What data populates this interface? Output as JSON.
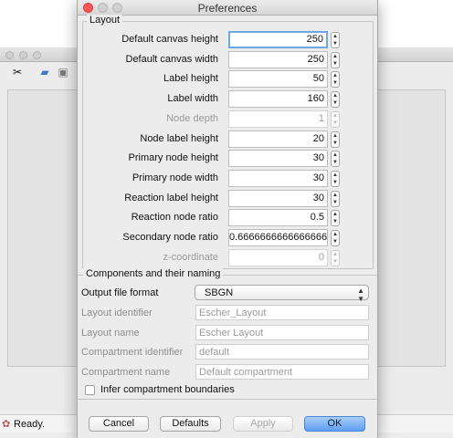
{
  "dialog": {
    "title": "Preferences"
  },
  "layout_group": {
    "legend": "Layout",
    "rows": [
      {
        "label": "Default canvas height",
        "value": "250",
        "enabled": true
      },
      {
        "label": "Default canvas width",
        "value": "250",
        "enabled": true
      },
      {
        "label": "Label height",
        "value": "50",
        "enabled": true
      },
      {
        "label": "Label width",
        "value": "160",
        "enabled": true
      },
      {
        "label": "Node depth",
        "value": "1",
        "enabled": false
      },
      {
        "label": "Node label height",
        "value": "20",
        "enabled": true
      },
      {
        "label": "Primary node height",
        "value": "30",
        "enabled": true
      },
      {
        "label": "Primary node width",
        "value": "30",
        "enabled": true
      },
      {
        "label": "Reaction label height",
        "value": "30",
        "enabled": true
      },
      {
        "label": "Reaction node ratio",
        "value": "0.5",
        "enabled": true
      },
      {
        "label": "Secondary node ratio",
        "value": "0.6666666666666666",
        "enabled": true
      },
      {
        "label": "z-coordinate",
        "value": "0",
        "enabled": false
      }
    ]
  },
  "naming_group": {
    "legend": "Components and their naming",
    "output_format_label": "Output file format",
    "output_format_value": "SBGN",
    "layout_id_label": "Layout identifier",
    "layout_id_value": "Escher_Layout",
    "layout_name_label": "Layout name",
    "layout_name_value": "Escher Layout",
    "compartment_id_label": "Compartment identifier",
    "compartment_id_value": "default",
    "compartment_name_label": "Compartment name",
    "compartment_name_value": "Default compartment",
    "infer_label": "Infer compartment boundaries"
  },
  "buttons": {
    "cancel": "Cancel",
    "defaults": "Defaults",
    "apply": "Apply",
    "ok": "OK"
  },
  "background_app": {
    "status": "Ready."
  },
  "colors": {
    "ok_button": "#5f9ff0",
    "close_light": "#fc5753",
    "focus_ring": "#6fa6e6"
  }
}
